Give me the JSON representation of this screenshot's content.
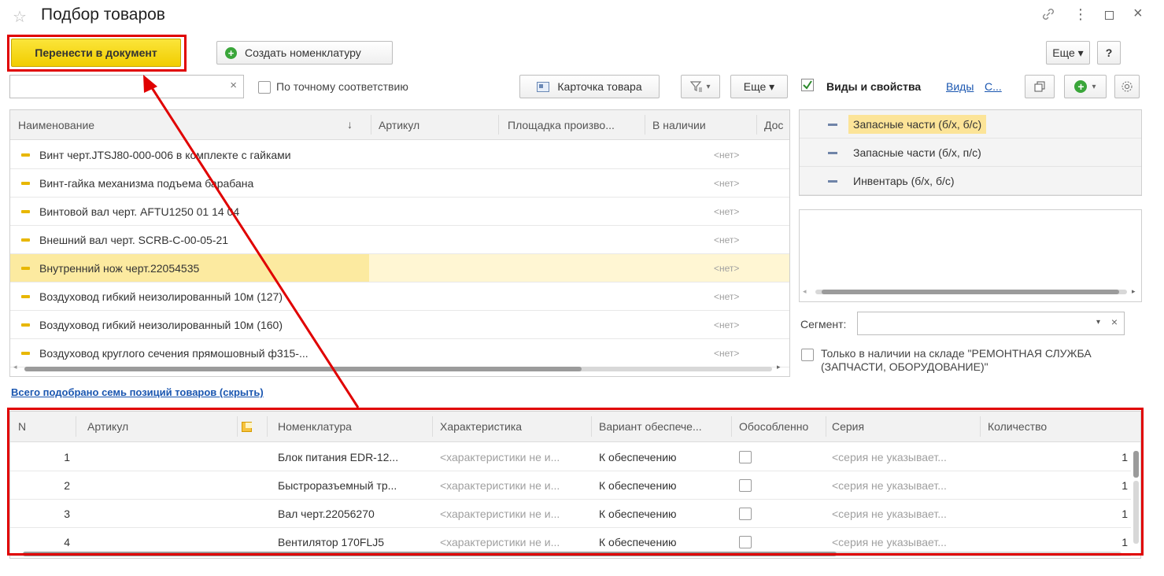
{
  "window": {
    "title": "Подбор товаров",
    "star_icon": "star-icon",
    "link_icon": "link-icon",
    "more_icon": "more-vertical-icon",
    "maximize_icon": "maximize-icon",
    "close_icon": "close-icon"
  },
  "toolbar": {
    "transfer_label": "Перенести в документ",
    "create_label": "Создать номенклатуру",
    "more_label": "Еще ▾",
    "help_label": "?"
  },
  "search": {
    "value": "",
    "clear": "×",
    "exact_match_label": "По точному соответствию",
    "card_label": "Карточка товара",
    "more_label": "Еще ▾"
  },
  "products": {
    "columns": [
      "Наименование",
      "Артикул",
      "Площадка произво...",
      "В наличии",
      "Дос"
    ],
    "sort_indicator": "↓",
    "rows": [
      {
        "name": "Винт черт.JTSJ80-000-006 в комплекте с гайками",
        "stock": "<нет>"
      },
      {
        "name": "Винт-гайка механизма подъема барабана",
        "stock": "<нет>"
      },
      {
        "name": "Винтовой вал черт. AFTU1250 01 14 04",
        "stock": "<нет>"
      },
      {
        "name": "Внешний вал черт. SCRB-C-00-05-21",
        "stock": "<нет>"
      },
      {
        "name": "Внутренний нож черт.22054535",
        "stock": "<нет>"
      },
      {
        "name": "Воздуховод гибкий неизолированный 10м (127)",
        "stock": "<нет>"
      },
      {
        "name": "Воздуховод гибкий неизолированный 10м (160)",
        "stock": "<нет>"
      },
      {
        "name": "Воздуховод круглого сечения прямошовный ф315-...",
        "stock": "<нет>"
      }
    ]
  },
  "right_panel": {
    "header_label": "Виды и свойства",
    "link_kinds": "Виды",
    "link_other": "С...",
    "kinds": [
      "Запасные части (б/х, б/с)",
      "Запасные части (б/х, п/с)",
      "Инвентарь (б/х, б/с)"
    ],
    "segment_label": "Сегмент:",
    "segment_value": "",
    "stock_only_label": "Только в наличии на складе \"РЕМОНТНАЯ СЛУЖБА (ЗАПЧАСТИ, ОБОРУДОВАНИЕ)\""
  },
  "summary_link": "Всего подобрано семь позиций товаров (скрыть)",
  "selected": {
    "columns": [
      "N",
      "Артикул",
      "",
      "Номенклатура",
      "Характеристика",
      "Вариант обеспече...",
      "Обособленно",
      "Серия",
      "Количество"
    ],
    "rows": [
      {
        "n": "1",
        "name": "Блок питания EDR-12...",
        "char": "<характеристики не и...",
        "variant": "К обеспечению",
        "series": "<серия не указывает...",
        "qty": "1"
      },
      {
        "n": "2",
        "name": "Быстроразъемный тр...",
        "char": "<характеристики не и...",
        "variant": "К обеспечению",
        "series": "<серия не указывает...",
        "qty": "1"
      },
      {
        "n": "3",
        "name": "Вал черт.22056270",
        "char": "<характеристики не и...",
        "variant": "К обеспечению",
        "series": "<серия не указывает...",
        "qty": "1"
      },
      {
        "n": "4",
        "name": "Вентилятор 170FLJ5",
        "char": "<характеристики не и...",
        "variant": "К обеспечению",
        "series": "<серия не указывает...",
        "qty": "1"
      }
    ]
  },
  "colors": {
    "accent_yellow": "#f5d80f",
    "highlight": "#fdf3c3",
    "annotation_red": "#e00000",
    "link_blue": "#1a56b0",
    "green": "#3aa63a"
  }
}
